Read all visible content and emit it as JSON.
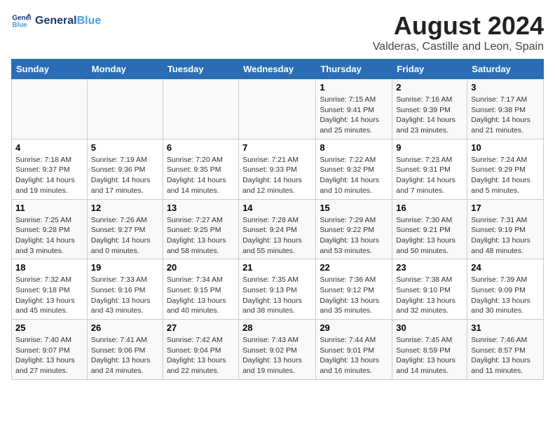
{
  "header": {
    "logo_line1": "General",
    "logo_line2": "Blue",
    "month_year": "August 2024",
    "location": "Valderas, Castille and Leon, Spain"
  },
  "weekdays": [
    "Sunday",
    "Monday",
    "Tuesday",
    "Wednesday",
    "Thursday",
    "Friday",
    "Saturday"
  ],
  "weeks": [
    [
      {
        "day": "",
        "info": ""
      },
      {
        "day": "",
        "info": ""
      },
      {
        "day": "",
        "info": ""
      },
      {
        "day": "",
        "info": ""
      },
      {
        "day": "1",
        "info": "Sunrise: 7:15 AM\nSunset: 9:41 PM\nDaylight: 14 hours\nand 25 minutes."
      },
      {
        "day": "2",
        "info": "Sunrise: 7:16 AM\nSunset: 9:39 PM\nDaylight: 14 hours\nand 23 minutes."
      },
      {
        "day": "3",
        "info": "Sunrise: 7:17 AM\nSunset: 9:38 PM\nDaylight: 14 hours\nand 21 minutes."
      }
    ],
    [
      {
        "day": "4",
        "info": "Sunrise: 7:18 AM\nSunset: 9:37 PM\nDaylight: 14 hours\nand 19 minutes."
      },
      {
        "day": "5",
        "info": "Sunrise: 7:19 AM\nSunset: 9:36 PM\nDaylight: 14 hours\nand 17 minutes."
      },
      {
        "day": "6",
        "info": "Sunrise: 7:20 AM\nSunset: 9:35 PM\nDaylight: 14 hours\nand 14 minutes."
      },
      {
        "day": "7",
        "info": "Sunrise: 7:21 AM\nSunset: 9:33 PM\nDaylight: 14 hours\nand 12 minutes."
      },
      {
        "day": "8",
        "info": "Sunrise: 7:22 AM\nSunset: 9:32 PM\nDaylight: 14 hours\nand 10 minutes."
      },
      {
        "day": "9",
        "info": "Sunrise: 7:23 AM\nSunset: 9:31 PM\nDaylight: 14 hours\nand 7 minutes."
      },
      {
        "day": "10",
        "info": "Sunrise: 7:24 AM\nSunset: 9:29 PM\nDaylight: 14 hours\nand 5 minutes."
      }
    ],
    [
      {
        "day": "11",
        "info": "Sunrise: 7:25 AM\nSunset: 9:28 PM\nDaylight: 14 hours\nand 3 minutes."
      },
      {
        "day": "12",
        "info": "Sunrise: 7:26 AM\nSunset: 9:27 PM\nDaylight: 14 hours\nand 0 minutes."
      },
      {
        "day": "13",
        "info": "Sunrise: 7:27 AM\nSunset: 9:25 PM\nDaylight: 13 hours\nand 58 minutes."
      },
      {
        "day": "14",
        "info": "Sunrise: 7:28 AM\nSunset: 9:24 PM\nDaylight: 13 hours\nand 55 minutes."
      },
      {
        "day": "15",
        "info": "Sunrise: 7:29 AM\nSunset: 9:22 PM\nDaylight: 13 hours\nand 53 minutes."
      },
      {
        "day": "16",
        "info": "Sunrise: 7:30 AM\nSunset: 9:21 PM\nDaylight: 13 hours\nand 50 minutes."
      },
      {
        "day": "17",
        "info": "Sunrise: 7:31 AM\nSunset: 9:19 PM\nDaylight: 13 hours\nand 48 minutes."
      }
    ],
    [
      {
        "day": "18",
        "info": "Sunrise: 7:32 AM\nSunset: 9:18 PM\nDaylight: 13 hours\nand 45 minutes."
      },
      {
        "day": "19",
        "info": "Sunrise: 7:33 AM\nSunset: 9:16 PM\nDaylight: 13 hours\nand 43 minutes."
      },
      {
        "day": "20",
        "info": "Sunrise: 7:34 AM\nSunset: 9:15 PM\nDaylight: 13 hours\nand 40 minutes."
      },
      {
        "day": "21",
        "info": "Sunrise: 7:35 AM\nSunset: 9:13 PM\nDaylight: 13 hours\nand 38 minutes."
      },
      {
        "day": "22",
        "info": "Sunrise: 7:36 AM\nSunset: 9:12 PM\nDaylight: 13 hours\nand 35 minutes."
      },
      {
        "day": "23",
        "info": "Sunrise: 7:38 AM\nSunset: 9:10 PM\nDaylight: 13 hours\nand 32 minutes."
      },
      {
        "day": "24",
        "info": "Sunrise: 7:39 AM\nSunset: 9:09 PM\nDaylight: 13 hours\nand 30 minutes."
      }
    ],
    [
      {
        "day": "25",
        "info": "Sunrise: 7:40 AM\nSunset: 9:07 PM\nDaylight: 13 hours\nand 27 minutes."
      },
      {
        "day": "26",
        "info": "Sunrise: 7:41 AM\nSunset: 9:06 PM\nDaylight: 13 hours\nand 24 minutes."
      },
      {
        "day": "27",
        "info": "Sunrise: 7:42 AM\nSunset: 9:04 PM\nDaylight: 13 hours\nand 22 minutes."
      },
      {
        "day": "28",
        "info": "Sunrise: 7:43 AM\nSunset: 9:02 PM\nDaylight: 13 hours\nand 19 minutes."
      },
      {
        "day": "29",
        "info": "Sunrise: 7:44 AM\nSunset: 9:01 PM\nDaylight: 13 hours\nand 16 minutes."
      },
      {
        "day": "30",
        "info": "Sunrise: 7:45 AM\nSunset: 8:59 PM\nDaylight: 13 hours\nand 14 minutes."
      },
      {
        "day": "31",
        "info": "Sunrise: 7:46 AM\nSunset: 8:57 PM\nDaylight: 13 hours\nand 11 minutes."
      }
    ]
  ]
}
